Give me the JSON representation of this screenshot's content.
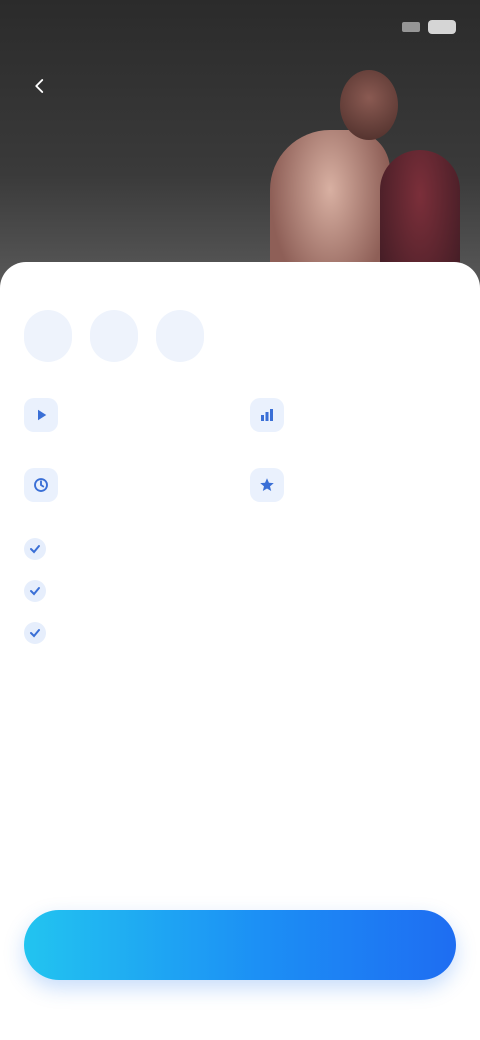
{
  "status_bar": {
    "time": "",
    "network_label": ""
  },
  "hero": {
    "title": ""
  },
  "description": "",
  "tabs": [
    {
      "label": ""
    },
    {
      "label": ""
    },
    {
      "label": ""
    }
  ],
  "features_section": {
    "title": "",
    "items": [
      {
        "name": "",
        "sub": "",
        "icon": "play-icon"
      },
      {
        "name": "",
        "sub": "",
        "icon": "chart-icon"
      },
      {
        "name": "",
        "sub": "",
        "icon": "clock-icon"
      },
      {
        "name": "",
        "sub": "",
        "icon": "star-icon"
      }
    ]
  },
  "benefits_section": {
    "title": "",
    "items": [
      {
        "text": ""
      },
      {
        "text": ""
      },
      {
        "text": ""
      }
    ]
  },
  "cta": {
    "label": ""
  },
  "footer": {
    "link_label": ""
  },
  "colors": {
    "accent": "#1e6df2",
    "accent_light": "#22c4f0",
    "hero_bg": "#2b2b2b"
  }
}
